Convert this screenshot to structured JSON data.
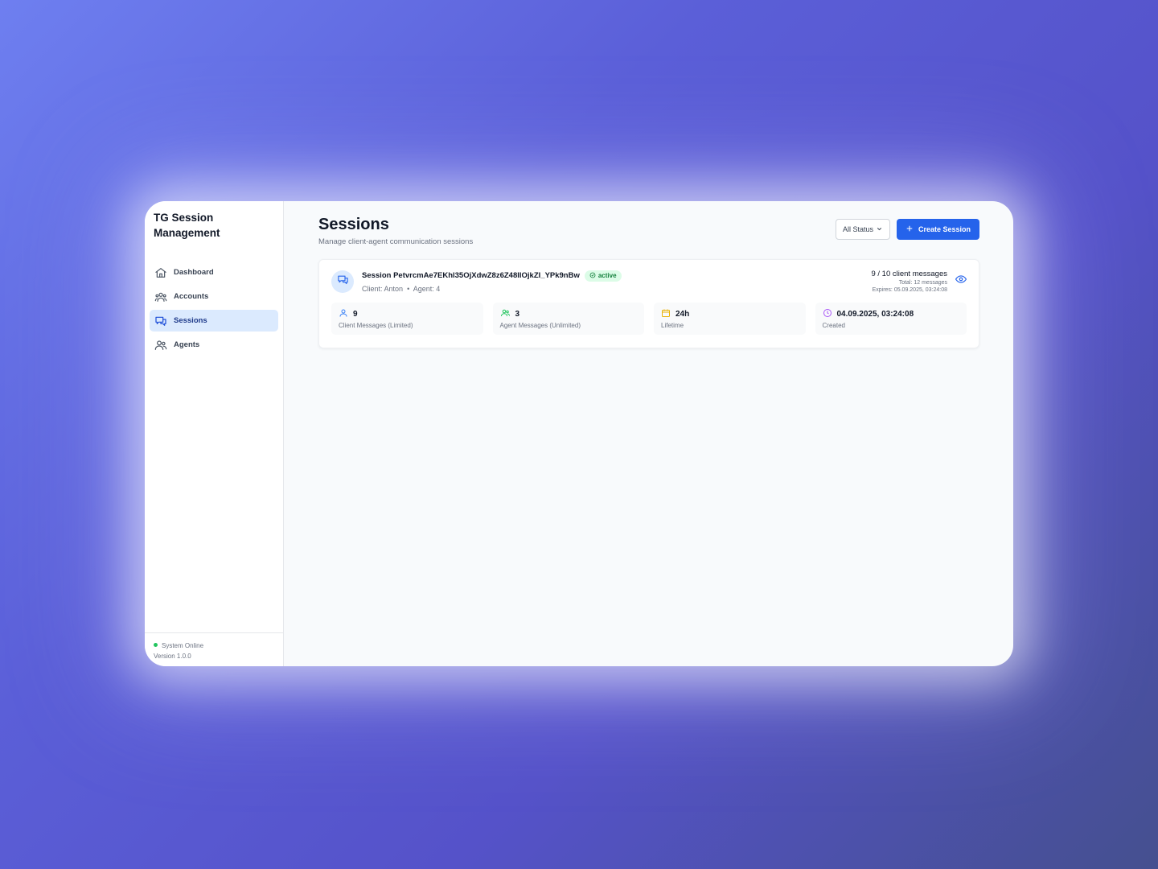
{
  "app": {
    "brand": "TG Session Management"
  },
  "sidebar": {
    "items": [
      {
        "label": "Dashboard",
        "icon": "home-icon"
      },
      {
        "label": "Accounts",
        "icon": "users-icon"
      },
      {
        "label": "Sessions",
        "icon": "chat-icon",
        "active": true
      },
      {
        "label": "Agents",
        "icon": "user-group-icon"
      }
    ],
    "footer": {
      "status": "System Online",
      "version": "Version 1.0.0"
    }
  },
  "header": {
    "title": "Sessions",
    "subtitle": "Manage client-agent communication sessions",
    "filter_label": "All Status",
    "create_label": "Create Session"
  },
  "session": {
    "name": "Session PetvrcmAe7EKhl35OjXdwZ8z6Z48IlOjkZI_YPk9nBw",
    "status": "active",
    "client": "Client: Anton",
    "agent": "Agent: 4",
    "messages": "9 / 10 client messages",
    "total": "Total: 12 messages",
    "expires": "Expires: 05.09.2025, 03:24:08",
    "stats": [
      {
        "value": "9",
        "label": "Client Messages (Limited)",
        "icon": "user-icon"
      },
      {
        "value": "3",
        "label": "Agent Messages (Unlimited)",
        "icon": "users-icon"
      },
      {
        "value": "24h",
        "label": "Lifetime",
        "icon": "calendar-icon"
      },
      {
        "value": "04.09.2025, 03:24:08",
        "label": "Created",
        "icon": "clock-icon"
      }
    ]
  },
  "colors": {
    "accent": "#2563eb",
    "active_bg": "#dbeafe",
    "success": "#22c55e"
  }
}
